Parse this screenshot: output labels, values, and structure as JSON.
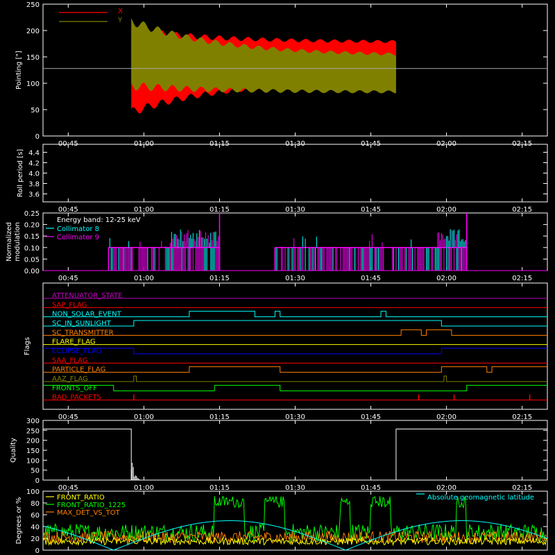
{
  "time_ticks": [
    "00:45",
    "01:00",
    "01:15",
    "01:30",
    "01:45",
    "02:00",
    "02:15"
  ],
  "chart_data": [
    {
      "type": "area",
      "ylabel": "Pointing [\"]",
      "ylim": [
        0,
        250
      ],
      "yticks": [
        "0",
        "50",
        "100",
        "150",
        "200",
        "250"
      ],
      "legend": [
        {
          "name": "X",
          "color": "#ff0000"
        },
        {
          "name": "Y",
          "color": "#808000"
        }
      ],
      "reference_level": 128,
      "data_start": "00:57:30",
      "data_end": "01:50:00",
      "series": [
        {
          "name": "X",
          "envelope_start": [
            45,
            200
          ],
          "envelope_end": [
            105,
            178
          ],
          "color": "#ff0000"
        },
        {
          "name": "Y",
          "envelope_start": [
            95,
            218
          ],
          "envelope_end": [
            83,
            152
          ],
          "color": "#808000"
        }
      ]
    },
    {
      "type": "line",
      "ylabel": "Roll period [s]",
      "ylim": [
        3.5,
        4.5
      ],
      "yticks": [
        "3.6",
        "3.8",
        "4.0",
        "4.2",
        "4.4"
      ]
    },
    {
      "type": "line",
      "ylabel_lines": [
        "Normalized",
        "modulation"
      ],
      "ylim": [
        0,
        0.25
      ],
      "yticks": [
        "0.00",
        "0.05",
        "0.10",
        "0.15",
        "0.20",
        "0.25"
      ],
      "annotation": "Energy band: 12-25 keV",
      "legend": [
        {
          "name": "Collimator 8",
          "color": "#00ffff"
        },
        {
          "name": "Collimator 9",
          "color": "#ff00ff"
        }
      ],
      "segments": [
        [
          "00:53:00",
          "01:15:00"
        ],
        [
          "01:26:00",
          "02:04:00"
        ]
      ],
      "typical_value": 0.1,
      "peak_value": 0.25
    },
    {
      "type": "line",
      "ylabel": "Flags",
      "flags": [
        {
          "name": "ATTENUATOR_STATE",
          "color": "#c000c0",
          "steps": []
        },
        {
          "name": "SAP_FLAG",
          "color": "#ff0000",
          "steps": []
        },
        {
          "name": "NON_SOLAR_EVENT",
          "color": "#00ffff",
          "steps": [
            [
              "01:09:00",
              "01:22:00"
            ],
            [
              "01:26:00",
              "01:27:00"
            ],
            [
              "01:47:00",
              "01:48:00"
            ]
          ]
        },
        {
          "name": "SC_IN_SUNLIGHT",
          "color": "#00ffff",
          "steps": [
            [
              "00:58:00",
              "01:59:00"
            ]
          ]
        },
        {
          "name": "SC_TRANSMITTER",
          "color": "#ff8000",
          "steps": [
            [
              "01:51:00",
              "01:55:00"
            ],
            [
              "01:56:00",
              "02:01:00"
            ]
          ]
        },
        {
          "name": "FLARE_FLAG",
          "color": "#ffff00",
          "steps": []
        },
        {
          "name": "ECLIPSE_FLAG",
          "color": "#0000ff",
          "steps": [
            [
              "00:40:00",
              "00:58:00"
            ],
            [
              "01:59:00",
              "02:20:00"
            ]
          ]
        },
        {
          "name": "SAA_FLAG",
          "color": "#ff0000",
          "steps": []
        },
        {
          "name": "PARTICLE_FLAG",
          "color": "#ff8000",
          "steps": [
            [
              "01:09:00",
              "01:27:00"
            ],
            [
              "01:59:00",
              "02:08:00"
            ],
            [
              "02:09:00",
              "02:20:00"
            ]
          ]
        },
        {
          "name": "AAZ_FLAG",
          "color": "#808000",
          "steps": [
            [
              "00:58:00",
              "00:58:30"
            ],
            [
              "01:59:30",
              "02:00:00"
            ]
          ]
        },
        {
          "name": "FRONTS_OFF",
          "color": "#00ff00",
          "steps": [
            [
              "00:40:00",
              "00:54:00"
            ],
            [
              "01:14:00",
              "01:27:00"
            ],
            [
              "02:04:00",
              "02:20:00"
            ]
          ]
        },
        {
          "name": "BAD_PACKETS",
          "color": "#ff0000",
          "spikes": [
            "00:58:00",
            "01:54:30",
            "02:01:30",
            "02:16:30"
          ]
        }
      ]
    },
    {
      "type": "line",
      "ylabel": "Quality",
      "ylim": [
        0,
        300
      ],
      "yticks": [
        "0",
        "50",
        "100",
        "150",
        "200",
        "250",
        "300"
      ],
      "segments": [
        {
          "x": [
            "00:40:00",
            "00:57:30"
          ],
          "y": 257
        },
        {
          "x": [
            "00:57:30",
            "00:59:30"
          ],
          "y": "decay"
        },
        {
          "x": [
            "01:50:00",
            "02:20:00"
          ],
          "y": 257
        }
      ]
    },
    {
      "type": "line",
      "ylabel": "Degrees or %",
      "ylim": [
        0,
        100
      ],
      "yticks": [
        "0",
        "20",
        "40",
        "60",
        "80",
        "100"
      ],
      "legend": [
        {
          "name": "FRONT_RATIO",
          "color": "#ffff00"
        },
        {
          "name": "FRONT_RATIO_1225",
          "color": "#00ff00"
        },
        {
          "name": "MAX_DET_VS_TOT",
          "color": "#ff8000"
        }
      ],
      "right_legend": {
        "name": "Absolute geomagnetic latitude",
        "color": "#00ffff"
      },
      "series_levels": [
        {
          "name": "MAX_DET_VS_TOT",
          "mean": 22,
          "noise": 10
        },
        {
          "name": "FRONT_RATIO",
          "mean": 15,
          "noise": 6
        },
        {
          "name": "FRONT_RATIO_1225",
          "mean": 30,
          "noise": 15,
          "elevated_segments": [
            [
              "01:14:00",
              "01:20:00"
            ],
            [
              "01:24:00",
              "01:28:00"
            ],
            [
              "01:39:00",
              "01:41:00"
            ],
            [
              "01:45:00",
              "01:49:00"
            ],
            [
              "02:02:00",
              "02:04:00"
            ]
          ],
          "elevated_level": 82
        },
        {
          "name": "Absolute geomagnetic latitude",
          "amplitude": 50,
          "period_minutes": 46,
          "phase": "01:17:00"
        }
      ]
    }
  ]
}
